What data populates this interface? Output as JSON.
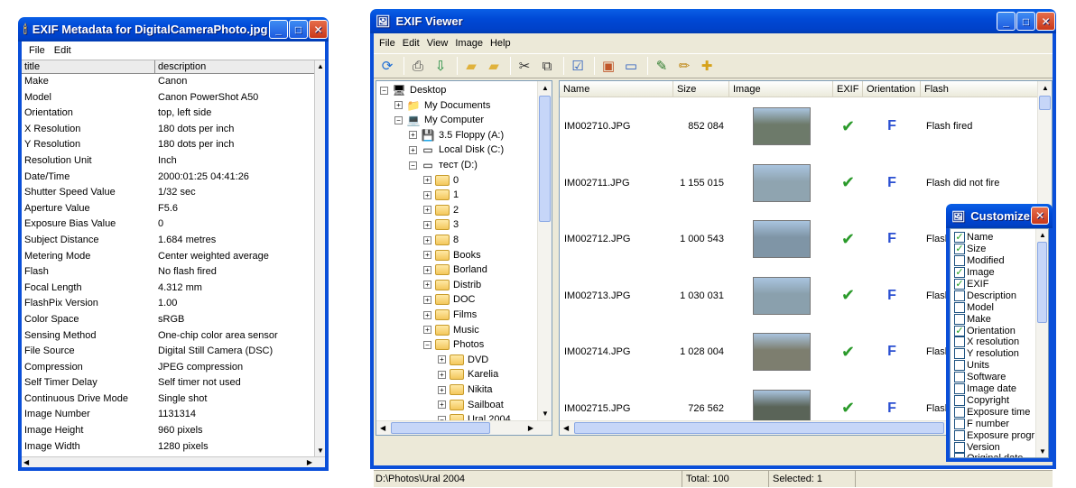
{
  "exif_window": {
    "title": "EXIF Metadata for DigitalCameraPhoto.jpg",
    "menu": [
      "File",
      "Edit"
    ],
    "columns": [
      "title",
      "description"
    ],
    "rows": [
      [
        "Make",
        "Canon"
      ],
      [
        "Model",
        "Canon PowerShot A50"
      ],
      [
        "Orientation",
        "top, left side"
      ],
      [
        "X Resolution",
        "180 dots per inch"
      ],
      [
        "Y Resolution",
        "180 dots per inch"
      ],
      [
        "Resolution Unit",
        "Inch"
      ],
      [
        "Date/Time",
        "2000:01:25 04:41:26"
      ],
      [
        "Shutter Speed Value",
        "1/32 sec"
      ],
      [
        "Aperture Value",
        "F5.6"
      ],
      [
        "Exposure Bias Value",
        "0"
      ],
      [
        "Subject Distance",
        "1.684 metres"
      ],
      [
        "Metering Mode",
        "Center weighted average"
      ],
      [
        "Flash",
        "No flash fired"
      ],
      [
        "Focal Length",
        "4.312 mm"
      ],
      [
        "FlashPix Version",
        "1.00"
      ],
      [
        "Color Space",
        "sRGB"
      ],
      [
        "Sensing Method",
        "One-chip color area sensor"
      ],
      [
        "File Source",
        "Digital Still Camera (DSC)"
      ],
      [
        "Compression",
        "JPEG compression"
      ],
      [
        "Self Timer Delay",
        "Self timer not used"
      ],
      [
        "Continuous Drive Mode",
        "Single shot"
      ],
      [
        "Image Number",
        "1131314"
      ],
      [
        "Image Height",
        "960 pixels"
      ],
      [
        "Image Width",
        "1280 pixels"
      ]
    ]
  },
  "viewer": {
    "title": "EXIF Viewer",
    "menu": [
      "File",
      "Edit",
      "View",
      "Image",
      "Help"
    ],
    "toolbar_icons": [
      "refresh-icon",
      "print-icon",
      "save-icon",
      "new-folder-icon",
      "folder-icon",
      "cut-icon",
      "copy-icon",
      "checklist-icon",
      "picture-icon",
      "monitor-icon",
      "edit-icon",
      "pencil-icon",
      "add-icon"
    ],
    "tree": [
      {
        "label": "Desktop",
        "level": 0,
        "sign": "−",
        "icon": "desktop-icon"
      },
      {
        "label": "My Documents",
        "level": 1,
        "sign": "+",
        "icon": "documents-icon"
      },
      {
        "label": "My Computer",
        "level": 1,
        "sign": "−",
        "icon": "computer-icon"
      },
      {
        "label": "3.5 Floppy (A:)",
        "level": 2,
        "sign": "+",
        "icon": "floppy-icon"
      },
      {
        "label": "Local Disk (C:)",
        "level": 2,
        "sign": "+",
        "icon": "disk-icon"
      },
      {
        "label": "тест (D:)",
        "level": 2,
        "sign": "−",
        "icon": "disk-icon"
      },
      {
        "label": "0",
        "level": 3,
        "sign": "+",
        "icon": "folder-icon"
      },
      {
        "label": "1",
        "level": 3,
        "sign": "+",
        "icon": "folder-icon"
      },
      {
        "label": "2",
        "level": 3,
        "sign": "+",
        "icon": "folder-icon"
      },
      {
        "label": "3",
        "level": 3,
        "sign": "+",
        "icon": "folder-icon"
      },
      {
        "label": "8",
        "level": 3,
        "sign": "+",
        "icon": "folder-icon"
      },
      {
        "label": "Books",
        "level": 3,
        "sign": "+",
        "icon": "folder-icon"
      },
      {
        "label": "Borland",
        "level": 3,
        "sign": "+",
        "icon": "folder-icon"
      },
      {
        "label": "Distrib",
        "level": 3,
        "sign": "+",
        "icon": "folder-icon"
      },
      {
        "label": "DOC",
        "level": 3,
        "sign": "+",
        "icon": "folder-icon"
      },
      {
        "label": "Films",
        "level": 3,
        "sign": "+",
        "icon": "folder-icon"
      },
      {
        "label": "Music",
        "level": 3,
        "sign": "+",
        "icon": "folder-icon"
      },
      {
        "label": "Photos",
        "level": 3,
        "sign": "−",
        "icon": "folder-icon"
      },
      {
        "label": "DVD",
        "level": 4,
        "sign": "+",
        "icon": "folder-icon"
      },
      {
        "label": "Karelia",
        "level": 4,
        "sign": "+",
        "icon": "folder-icon"
      },
      {
        "label": "Nikita",
        "level": 4,
        "sign": "+",
        "icon": "folder-icon"
      },
      {
        "label": "Sailboat",
        "level": 4,
        "sign": "+",
        "icon": "folder-icon"
      },
      {
        "label": "Ural 2004",
        "level": 4,
        "sign": "−",
        "icon": "folder-icon"
      }
    ],
    "list_columns": [
      "Name",
      "Size",
      "Image",
      "EXIF",
      "Orientation",
      "Flash"
    ],
    "files": [
      {
        "name": "IM002710.JPG",
        "size": "852 084",
        "exif": "✔",
        "orientation": "F",
        "flash": "Flash fired",
        "thumb": "#6d7a6a"
      },
      {
        "name": "IM002711.JPG",
        "size": "1 155 015",
        "exif": "✔",
        "orientation": "F",
        "flash": "Flash did not fire",
        "thumb": "#8fa4b0"
      },
      {
        "name": "IM002712.JPG",
        "size": "1 000 543",
        "exif": "✔",
        "orientation": "F",
        "flash": "Flash",
        "thumb": "#7f95a6"
      },
      {
        "name": "IM002713.JPG",
        "size": "1 030 031",
        "exif": "✔",
        "orientation": "F",
        "flash": "Flash",
        "thumb": "#8aa0ad"
      },
      {
        "name": "IM002714.JPG",
        "size": "1 028 004",
        "exif": "✔",
        "orientation": "F",
        "flash": "Flash",
        "thumb": "#7d7e6f"
      },
      {
        "name": "IM002715.JPG",
        "size": "726 562",
        "exif": "✔",
        "orientation": "F",
        "flash": "Flash",
        "thumb": "#5a6458"
      }
    ],
    "status": {
      "path": "D:\\Photos\\Ural 2004",
      "total": "Total: 100",
      "selected": "Selected: 1"
    }
  },
  "customize": {
    "title": "Customize",
    "items": [
      {
        "label": "Name",
        "checked": true
      },
      {
        "label": "Size",
        "checked": true
      },
      {
        "label": "Modified",
        "checked": false
      },
      {
        "label": "Image",
        "checked": true
      },
      {
        "label": "EXIF",
        "checked": true
      },
      {
        "label": "Description",
        "checked": false
      },
      {
        "label": "Model",
        "checked": false
      },
      {
        "label": "Make",
        "checked": false
      },
      {
        "label": "Orientation",
        "checked": true
      },
      {
        "label": "X resolution",
        "checked": false
      },
      {
        "label": "Y resolution",
        "checked": false
      },
      {
        "label": "Units",
        "checked": false
      },
      {
        "label": "Software",
        "checked": false
      },
      {
        "label": "Image date",
        "checked": false
      },
      {
        "label": "Copyright",
        "checked": false
      },
      {
        "label": "Exposure time",
        "checked": false
      },
      {
        "label": "F number",
        "checked": false
      },
      {
        "label": "Exposure progr",
        "checked": false
      },
      {
        "label": "Version",
        "checked": false
      },
      {
        "label": "Original date",
        "checked": false
      }
    ]
  },
  "colors": {
    "title_bar": "#0049d6",
    "check": "#2a9a2a",
    "orientation": "#2a4fd1",
    "client": "#ece9d8"
  }
}
